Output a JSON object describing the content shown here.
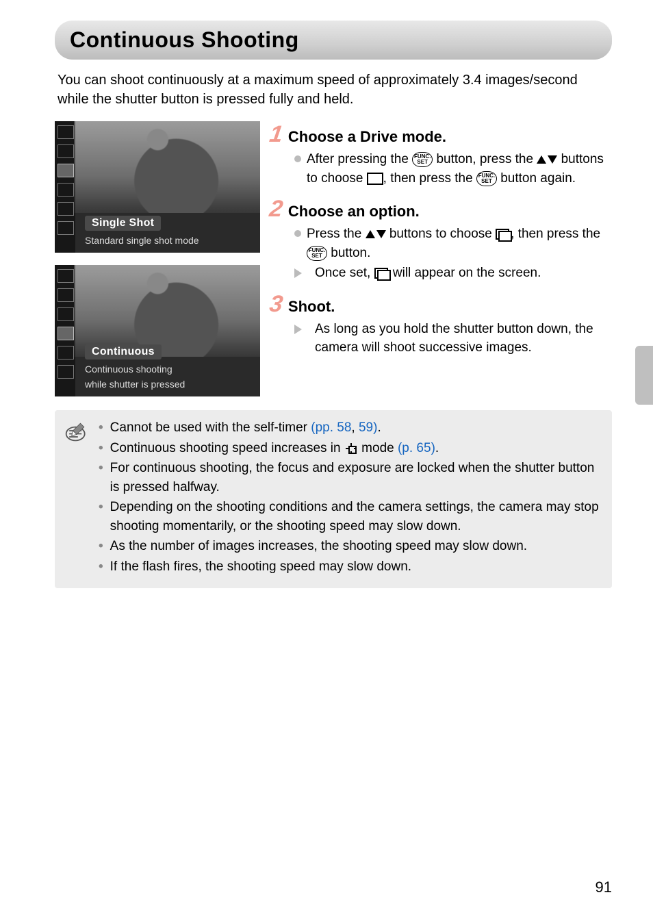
{
  "page": {
    "title": "Continuous Shooting",
    "intro": "You can shoot continuously at a maximum speed of approximately 3.4 images/second while the shutter button is pressed fully and held.",
    "number": "91"
  },
  "screenshots": {
    "single": {
      "label1": "Single Shot",
      "label2": "Standard single shot mode"
    },
    "cont": {
      "label1": "Continuous",
      "label2a": "Continuous shooting",
      "label2b": "while shutter is pressed"
    }
  },
  "steps": {
    "s1": {
      "num": "1",
      "title": "Choose a Drive mode.",
      "p1a": "After pressing the ",
      "p1b": " button, press the ",
      "p1c": " buttons to choose ",
      "p1d": ", then press the ",
      "p1e": " button again."
    },
    "s2": {
      "num": "2",
      "title": "Choose an option.",
      "p1a": "Press the ",
      "p1b": " buttons to choose ",
      "p1c": ", then press the ",
      "p1d": " button.",
      "p2a": "Once set, ",
      "p2b": " will appear on the screen."
    },
    "s3": {
      "num": "3",
      "title": "Shoot.",
      "p1": "As long as you hold the shutter button down, the camera will shoot successive images."
    }
  },
  "sym": {
    "func": "FUNC. SET"
  },
  "notes": {
    "n1a": "Cannot be used with the self-timer ",
    "n1_link1": "(pp. 58",
    "n1_comma": ", ",
    "n1_link2": "59)",
    "n1_period": ".",
    "n2a": "Continuous shooting speed increases in ",
    "n2b": " mode ",
    "n2_link": "(p. 65)",
    "n2_period": ".",
    "n3": "For continuous shooting, the focus and exposure are locked when the shutter button is pressed halfway.",
    "n4": "Depending on the shooting conditions and the camera settings, the camera may stop shooting momentarily, or the shooting speed may slow down.",
    "n5": "As the number of images increases, the shooting speed may slow down.",
    "n6": "If the flash fires, the shooting speed may slow down."
  }
}
